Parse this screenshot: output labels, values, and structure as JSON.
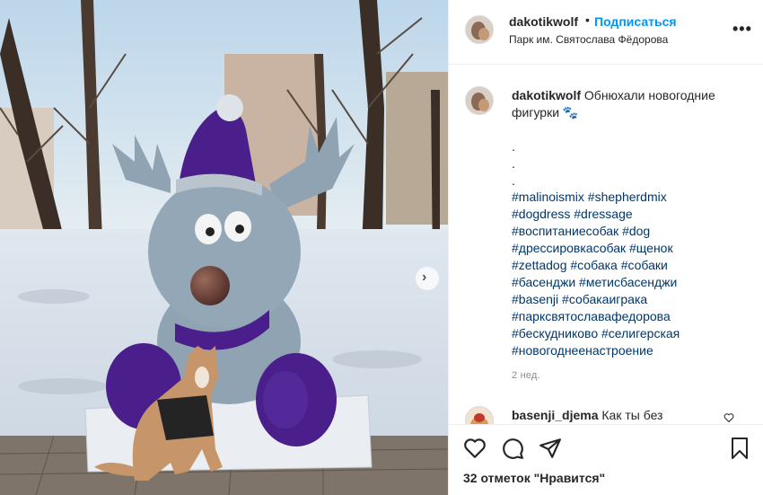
{
  "post": {
    "username": "dakotikwolf",
    "dot": "•",
    "follow_label": "Подписаться",
    "location": "Парк им. Святослава Фёдорова",
    "more_label": "•••"
  },
  "caption": {
    "username": "dakotikwolf",
    "text": "Обнюхали новогодние фигурки 🐾",
    "dots": [
      ".",
      ".",
      "."
    ],
    "hashtags": [
      "#malinoismix #shepherdmix",
      "#dogdress #dressage",
      "#воспитаниесобак #dog",
      "#дрессировкасобак #щенок",
      "#zettadog #собака #собаки",
      "#басенджи #метисбасенджи",
      "#basenji #собакаиграка",
      "#парксвятославафедорова",
      "#бескудниково #селигерская",
      "#новогоднеенастроение"
    ],
    "time": "2 нед."
  },
  "comment": {
    "username": "basenji_djema",
    "text": "Как ты без"
  },
  "likes": {
    "count": "32",
    "label": "отметок \"Нравится\""
  },
  "icons": {
    "like": "heart-icon",
    "comment": "comment-icon",
    "share": "paper-plane-icon",
    "save": "bookmark-icon",
    "more": "more-dots-icon",
    "next": "chevron-right-icon"
  },
  "colors": {
    "link": "#0095f6",
    "hashtag": "#00376b",
    "muted": "#8e8e8e",
    "border": "#efefef",
    "moose_fur": "#8fa3b3",
    "tinsel": "#4a1f8c"
  }
}
